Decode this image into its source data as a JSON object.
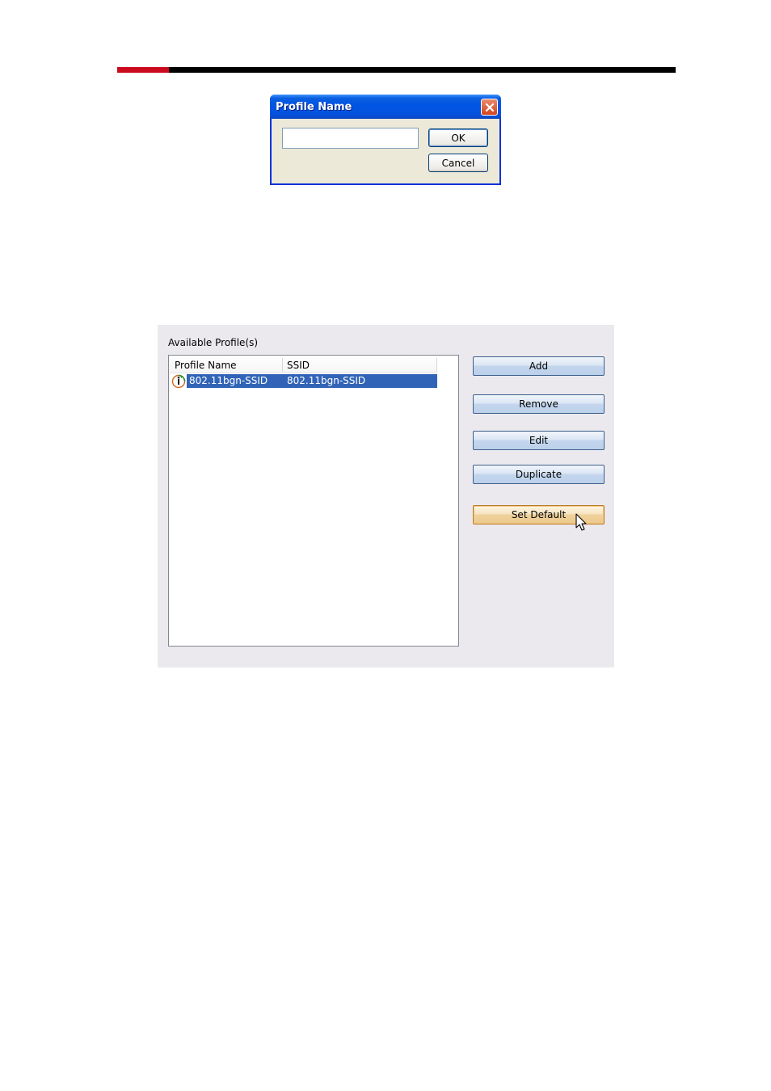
{
  "colors": {
    "header_red": "#cc0a1e",
    "header_black": "#000000",
    "selection": "#3164b7"
  },
  "dialog": {
    "title": "Profile Name",
    "input_value": "",
    "ok_label": "OK",
    "cancel_label": "Cancel"
  },
  "profiles_panel": {
    "label": "Available Profile(s)",
    "columns": [
      "Profile Name",
      "SSID"
    ],
    "rows": [
      {
        "profile_name": "802.11bgn-SSID",
        "ssid": "802.11bgn-SSID",
        "icon": "default-profile-icon",
        "selected": true
      }
    ],
    "buttons": {
      "add": "Add",
      "remove": "Remove",
      "edit": "Edit",
      "duplicate": "Duplicate",
      "set_default": "Set Default"
    }
  }
}
